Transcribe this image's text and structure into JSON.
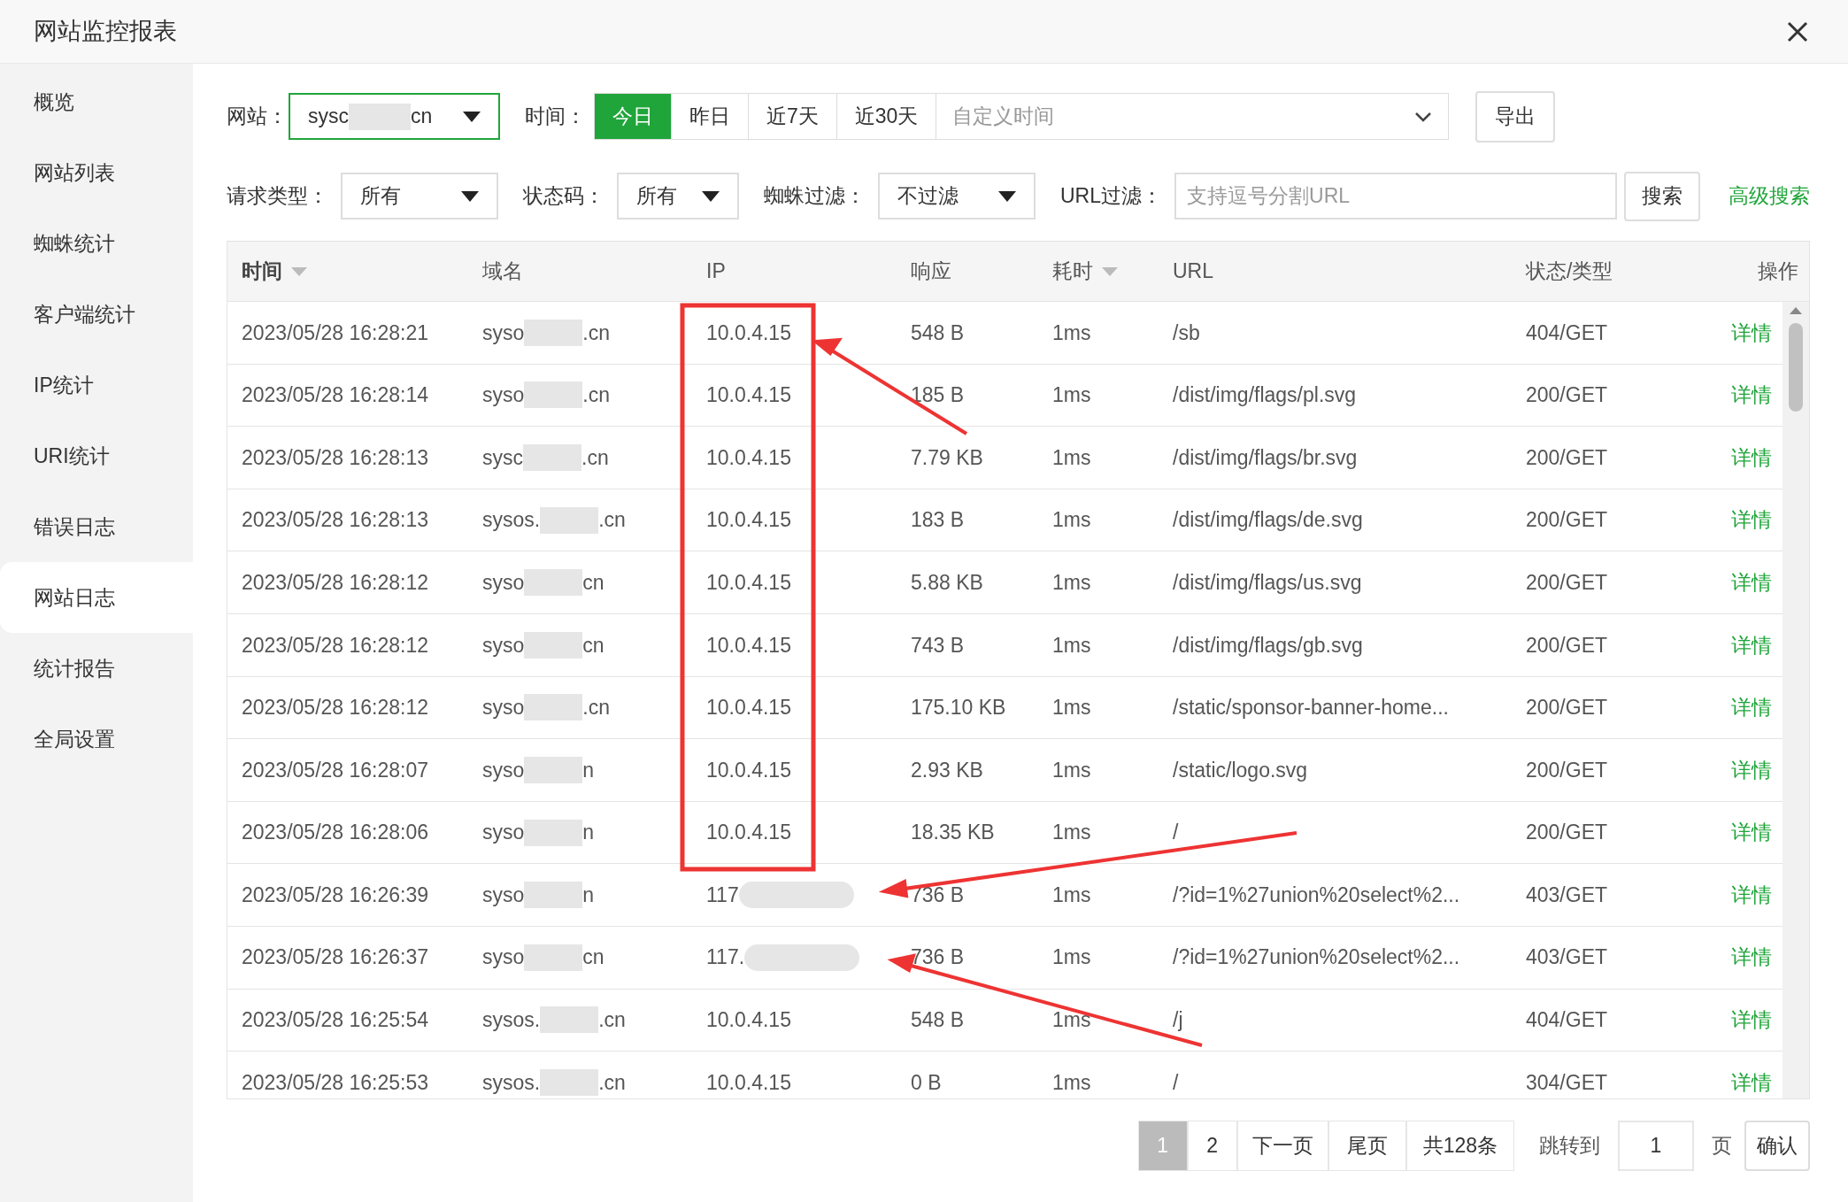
{
  "window": {
    "title": "网站监控报表"
  },
  "sidebar": {
    "items": [
      {
        "label": "概览",
        "selected": false
      },
      {
        "label": "网站列表",
        "selected": false
      },
      {
        "label": "蜘蛛统计",
        "selected": false
      },
      {
        "label": "客户端统计",
        "selected": false
      },
      {
        "label": "IP统计",
        "selected": false
      },
      {
        "label": "URI统计",
        "selected": false
      },
      {
        "label": "错误日志",
        "selected": false
      },
      {
        "label": "网站日志",
        "selected": true
      },
      {
        "label": "统计报告",
        "selected": false
      },
      {
        "label": "全局设置",
        "selected": false
      }
    ]
  },
  "filters": {
    "site": {
      "label": "网站：",
      "value_start": "sysc",
      "value_end": "cn"
    },
    "time": {
      "label": "时间：",
      "options": [
        {
          "label": "今日",
          "selected": true
        },
        {
          "label": "昨日",
          "selected": false
        },
        {
          "label": "近7天",
          "selected": false
        },
        {
          "label": "近30天",
          "selected": false
        }
      ],
      "custom_placeholder": "自定义时间"
    },
    "export": "导出",
    "selects": [
      {
        "label": "请求类型：",
        "value": "所有"
      },
      {
        "label": "状态码：",
        "value": "所有"
      },
      {
        "label": "蜘蛛过滤：",
        "value": "不过滤"
      }
    ],
    "url_filter": {
      "label": "URL过滤：",
      "placeholder": "支持逗号分割URL"
    },
    "search": "搜索",
    "advanced": "高级搜索"
  },
  "table": {
    "columns": [
      {
        "label": "时间",
        "sortable": true,
        "bold": true
      },
      {
        "label": "域名",
        "sortable": false,
        "bold": false
      },
      {
        "label": "IP",
        "sortable": false,
        "bold": false
      },
      {
        "label": "响应",
        "sortable": false,
        "bold": false
      },
      {
        "label": "耗时",
        "sortable": true,
        "bold": false
      },
      {
        "label": "URL",
        "sortable": false,
        "bold": false
      },
      {
        "label": "状态/类型",
        "sortable": false,
        "bold": false
      },
      {
        "label": "操作",
        "sortable": false,
        "bold": false
      }
    ],
    "rows": [
      {
        "time": "2023/05/28 16:28:21",
        "domain_start": "syso",
        "domain_end": ".cn",
        "ip": "10.0.4.15",
        "ip_masked": false,
        "size": "548 B",
        "duration": "1ms",
        "url": "/sb",
        "status": "404/GET",
        "action": "详情"
      },
      {
        "time": "2023/05/28 16:28:14",
        "domain_start": "syso",
        "domain_end": ".cn",
        "ip": "10.0.4.15",
        "ip_masked": false,
        "size": "185 B",
        "duration": "1ms",
        "url": "/dist/img/flags/pl.svg",
        "status": "200/GET",
        "action": "详情"
      },
      {
        "time": "2023/05/28 16:28:13",
        "domain_start": "sysc",
        "domain_end": ".cn",
        "ip": "10.0.4.15",
        "ip_masked": false,
        "size": "7.79 KB",
        "duration": "1ms",
        "url": "/dist/img/flags/br.svg",
        "status": "200/GET",
        "action": "详情"
      },
      {
        "time": "2023/05/28 16:28:13",
        "domain_start": "sysos.",
        "domain_end": ".cn",
        "ip": "10.0.4.15",
        "ip_masked": false,
        "size": "183 B",
        "duration": "1ms",
        "url": "/dist/img/flags/de.svg",
        "status": "200/GET",
        "action": "详情"
      },
      {
        "time": "2023/05/28 16:28:12",
        "domain_start": "syso",
        "domain_end": "cn",
        "ip": "10.0.4.15",
        "ip_masked": false,
        "size": "5.88 KB",
        "duration": "1ms",
        "url": "/dist/img/flags/us.svg",
        "status": "200/GET",
        "action": "详情"
      },
      {
        "time": "2023/05/28 16:28:12",
        "domain_start": "syso",
        "domain_end": "cn",
        "ip": "10.0.4.15",
        "ip_masked": false,
        "size": "743 B",
        "duration": "1ms",
        "url": "/dist/img/flags/gb.svg",
        "status": "200/GET",
        "action": "详情"
      },
      {
        "time": "2023/05/28 16:28:12",
        "domain_start": "syso",
        "domain_end": ".cn",
        "ip": "10.0.4.15",
        "ip_masked": false,
        "size": "175.10 KB",
        "duration": "1ms",
        "url": "/static/sponsor-banner-home...",
        "status": "200/GET",
        "action": "详情"
      },
      {
        "time": "2023/05/28 16:28:07",
        "domain_start": "syso",
        "domain_end": "n",
        "ip": "10.0.4.15",
        "ip_masked": false,
        "size": "2.93 KB",
        "duration": "1ms",
        "url": "/static/logo.svg",
        "status": "200/GET",
        "action": "详情"
      },
      {
        "time": "2023/05/28 16:28:06",
        "domain_start": "syso",
        "domain_end": "n",
        "ip": "10.0.4.15",
        "ip_masked": false,
        "size": "18.35 KB",
        "duration": "1ms",
        "url": "/",
        "status": "200/GET",
        "action": "详情"
      },
      {
        "time": "2023/05/28 16:26:39",
        "domain_start": "syso",
        "domain_end": "n",
        "ip": "117",
        "ip_masked": true,
        "size": "736 B",
        "duration": "1ms",
        "url": "/?id=1%27union%20select%2...",
        "status": "403/GET",
        "action": "详情"
      },
      {
        "time": "2023/05/28 16:26:37",
        "domain_start": "syso",
        "domain_end": "cn",
        "ip": "117.",
        "ip_masked": true,
        "size": "736 B",
        "duration": "1ms",
        "url": "/?id=1%27union%20select%2...",
        "status": "403/GET",
        "action": "详情"
      },
      {
        "time": "2023/05/28 16:25:54",
        "domain_start": "sysos.",
        "domain_end": ".cn",
        "ip": "10.0.4.15",
        "ip_masked": false,
        "size": "548 B",
        "duration": "1ms",
        "url": "/j",
        "status": "404/GET",
        "action": "详情"
      },
      {
        "time": "2023/05/28 16:25:53",
        "domain_start": "sysos.",
        "domain_end": ".cn",
        "ip": "10.0.4.15",
        "ip_masked": false,
        "size": "0 B",
        "duration": "1ms",
        "url": "/",
        "status": "304/GET",
        "action": "详情"
      }
    ]
  },
  "pagination": {
    "pages": [
      {
        "label": "1",
        "selected": true
      },
      {
        "label": "2",
        "selected": false
      }
    ],
    "next": "下一页",
    "last": "尾页",
    "total": "共128条",
    "jump_label": "跳转到",
    "jump_value": "1",
    "unit": "页",
    "confirm": "确认"
  }
}
